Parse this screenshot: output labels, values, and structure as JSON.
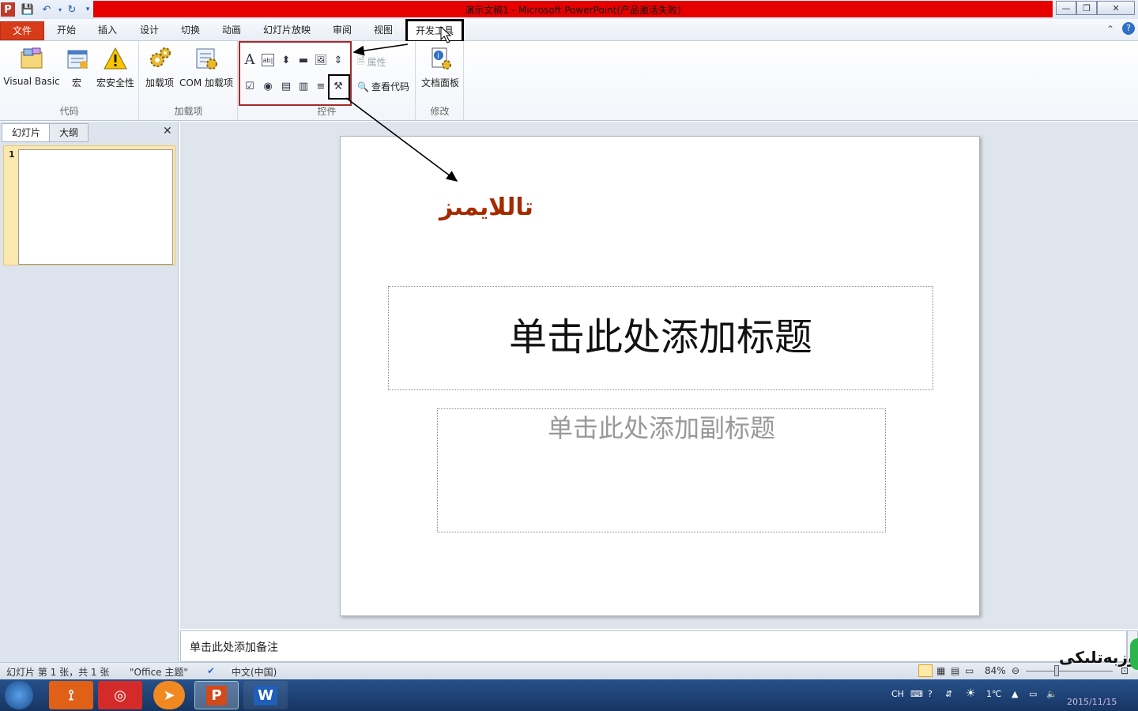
{
  "window": {
    "title": "演示文稿1 - Microsoft PowerPoint(产品激活失败)",
    "app_icon": "P"
  },
  "tabs": [
    {
      "label": "文件"
    },
    {
      "label": "开始"
    },
    {
      "label": "插入"
    },
    {
      "label": "设计"
    },
    {
      "label": "切换"
    },
    {
      "label": "动画"
    },
    {
      "label": "幻灯片放映"
    },
    {
      "label": "审阅"
    },
    {
      "label": "视图"
    },
    {
      "label": "开发工具"
    }
  ],
  "ribbon": {
    "groups": {
      "code": "代码",
      "addins": "加载项",
      "controls": "控件",
      "modify": "修改"
    },
    "buttons": {
      "visual_basic": "Visual Basic",
      "macro": "宏",
      "macro_security": "宏安全性",
      "addins": "加载项",
      "com_addins": "COM 加载项",
      "properties": "属性",
      "view_code": "查看代码",
      "doc_panel": "文档面板"
    }
  },
  "annotation": {
    "text": "تاللايمىز"
  },
  "left_pane": {
    "tab_slides": "幻灯片",
    "tab_outline": "大纲",
    "slide_number": "1"
  },
  "slide": {
    "title_placeholder": "单击此处添加标题",
    "subtitle_placeholder": "单击此处添加副标题"
  },
  "notes": {
    "placeholder": "单击此处添加备注"
  },
  "status": {
    "slide_info": "幻灯片 第 1 张，共 1 张",
    "theme": "\"Office 主题\"",
    "language": "中文(中国)",
    "zoom": "84%"
  },
  "taskbar": {
    "tray_lang": "CH",
    "temperature": "1℃",
    "date": "2015/11/15"
  },
  "watermark": "روزبەتلىكى"
}
